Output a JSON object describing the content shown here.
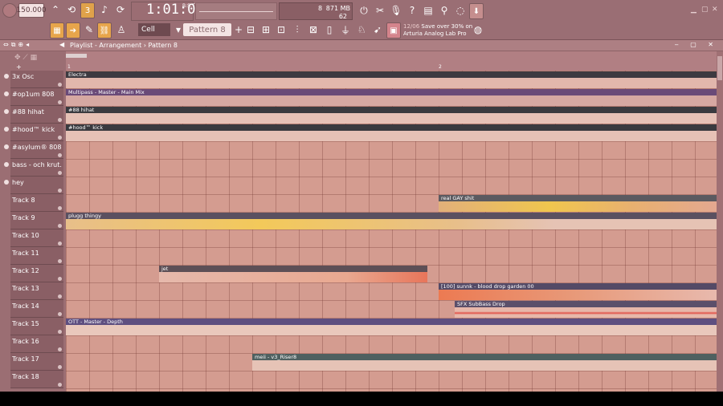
{
  "toolbar": {
    "tempo": "150.000",
    "time_main": "1:01:00",
    "time_sub": "B:S:T",
    "cpu_value": "8",
    "ram_value": "871 MB",
    "polyphony": "62",
    "snap": "Cell",
    "pattern": "Pattern 8",
    "news_date": "12/06",
    "news_text": "Save over 30% on Arturia Analog Lab Pro"
  },
  "playlist": {
    "title": "Playlist - Arrangement › Pattern 8",
    "ruler_marks": [
      "1",
      "2"
    ]
  },
  "tracks": [
    {
      "name": "3x Osc"
    },
    {
      "name": "#op1um 808"
    },
    {
      "name": "#88 hihat"
    },
    {
      "name": "#hood™ kick"
    },
    {
      "name": "#asylum® 808"
    },
    {
      "name": "bass - och krut."
    },
    {
      "name": "hey"
    },
    {
      "name": "Track 8"
    },
    {
      "name": "Track 9"
    },
    {
      "name": "Track 10"
    },
    {
      "name": "Track 11"
    },
    {
      "name": "Track 12"
    },
    {
      "name": "Track 13"
    },
    {
      "name": "Track 14"
    },
    {
      "name": "Track 15"
    },
    {
      "name": "Track 16"
    },
    {
      "name": "Track 17"
    },
    {
      "name": "Track 18"
    }
  ],
  "clips": [
    {
      "label": "Electra",
      "color": "#3d3a40"
    },
    {
      "label": "Multipass - Master - Main Mix",
      "color": "#6a4a78"
    },
    {
      "label": "#88 hihat",
      "color": "#3a3a3f"
    },
    {
      "label": "#hood™ kick",
      "color": "#3a3a3f"
    },
    {
      "label": "real GAY shit",
      "color": "#5b5a60"
    },
    {
      "label": "plugg thingy",
      "color": "#5a5060"
    },
    {
      "label": "jet",
      "color": "#5d4f56"
    },
    {
      "label": "[100] sunnk - blood drop garden 00",
      "color": "#544a66"
    },
    {
      "label": "SFX SubBass Drop",
      "color": "#5b4f6a"
    },
    {
      "label": "OTT - Master - Depth",
      "color": "#5e4f80"
    },
    {
      "label": "meii - v3_Riser8",
      "color": "#4f6060"
    }
  ]
}
